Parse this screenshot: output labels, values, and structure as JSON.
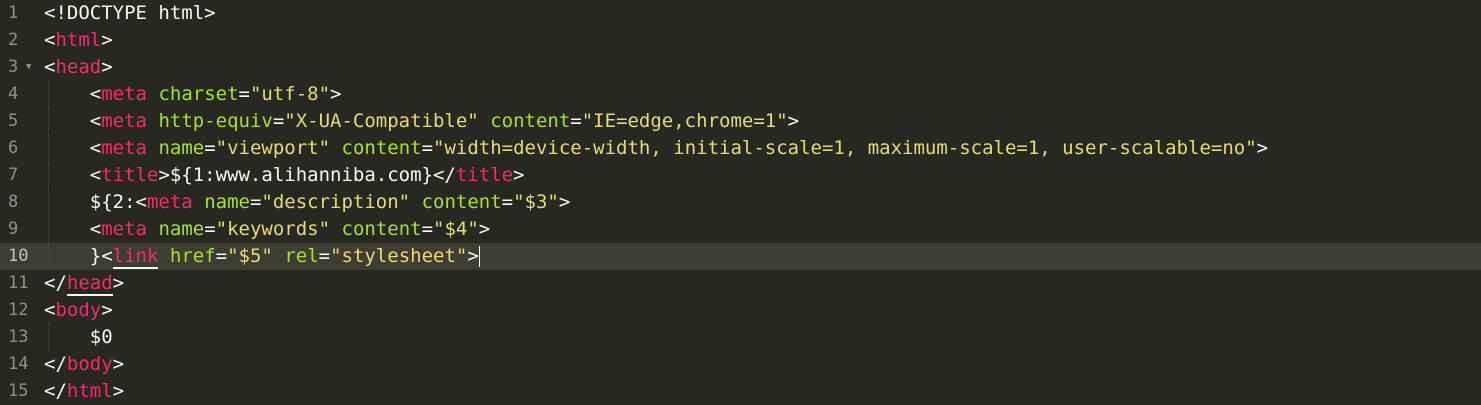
{
  "editor": {
    "lines": [
      {
        "num": "1",
        "indent": "",
        "tokens": [
          [
            "p",
            "<!DOCTYPE html>"
          ]
        ]
      },
      {
        "num": "2",
        "indent": "",
        "tokens": [
          [
            "p",
            "<"
          ],
          [
            "t",
            "html"
          ],
          [
            "p",
            ">"
          ]
        ]
      },
      {
        "num": "3",
        "indent": "",
        "fold": "▼",
        "tokens": [
          [
            "p",
            "<"
          ],
          [
            "t",
            "head"
          ],
          [
            "p",
            ">"
          ]
        ]
      },
      {
        "num": "4",
        "indent": "    ",
        "tokens": [
          [
            "p",
            "<"
          ],
          [
            "t",
            "meta"
          ],
          [
            "p",
            " "
          ],
          [
            "a",
            "charset"
          ],
          [
            "p",
            "="
          ],
          [
            "s",
            "\"utf-8\""
          ],
          [
            "p",
            ">"
          ]
        ]
      },
      {
        "num": "5",
        "indent": "    ",
        "tokens": [
          [
            "p",
            "<"
          ],
          [
            "t",
            "meta"
          ],
          [
            "p",
            " "
          ],
          [
            "a",
            "http-equiv"
          ],
          [
            "p",
            "="
          ],
          [
            "s",
            "\"X-UA-Compatible\""
          ],
          [
            "p",
            " "
          ],
          [
            "a",
            "content"
          ],
          [
            "p",
            "="
          ],
          [
            "s",
            "\"IE=edge,chrome=1\""
          ],
          [
            "p",
            ">"
          ]
        ]
      },
      {
        "num": "6",
        "indent": "    ",
        "tokens": [
          [
            "p",
            "<"
          ],
          [
            "t",
            "meta"
          ],
          [
            "p",
            " "
          ],
          [
            "a",
            "name"
          ],
          [
            "p",
            "="
          ],
          [
            "s",
            "\"viewport\""
          ],
          [
            "p",
            " "
          ],
          [
            "a",
            "content"
          ],
          [
            "p",
            "="
          ],
          [
            "s",
            "\"width=device-width, initial-scale=1, maximum-scale=1, user-scalable=no\""
          ],
          [
            "p",
            ">"
          ]
        ]
      },
      {
        "num": "7",
        "indent": "    ",
        "tokens": [
          [
            "p",
            "<"
          ],
          [
            "t",
            "title"
          ],
          [
            "p",
            ">${1:www.alihanniba.com}</"
          ],
          [
            "t",
            "title"
          ],
          [
            "p",
            ">"
          ]
        ]
      },
      {
        "num": "8",
        "indent": "    ",
        "tokens": [
          [
            "p",
            "${2:<"
          ],
          [
            "t",
            "meta"
          ],
          [
            "p",
            " "
          ],
          [
            "a",
            "name"
          ],
          [
            "p",
            "="
          ],
          [
            "s",
            "\"description\""
          ],
          [
            "p",
            " "
          ],
          [
            "a",
            "content"
          ],
          [
            "p",
            "="
          ],
          [
            "s",
            "\"$3\""
          ],
          [
            "p",
            ">"
          ]
        ]
      },
      {
        "num": "9",
        "indent": "    ",
        "tokens": [
          [
            "p",
            "<"
          ],
          [
            "t",
            "meta"
          ],
          [
            "p",
            " "
          ],
          [
            "a",
            "name"
          ],
          [
            "p",
            "="
          ],
          [
            "s",
            "\"keywords\""
          ],
          [
            "p",
            " "
          ],
          [
            "a",
            "content"
          ],
          [
            "p",
            "="
          ],
          [
            "s",
            "\"$4\""
          ],
          [
            "p",
            ">"
          ]
        ]
      },
      {
        "num": "10",
        "indent": "    ",
        "active": true,
        "tokens": [
          [
            "p",
            "}<"
          ],
          [
            "tm",
            "link"
          ],
          [
            "p",
            " "
          ],
          [
            "a",
            "href"
          ],
          [
            "p",
            "="
          ],
          [
            "s",
            "\"$5\""
          ],
          [
            "p",
            " "
          ],
          [
            "a",
            "rel"
          ],
          [
            "p",
            "="
          ],
          [
            "s",
            "\"stylesheet\""
          ],
          [
            "p",
            ">"
          ],
          [
            "cursor",
            ""
          ]
        ]
      },
      {
        "num": "11",
        "indent": "",
        "tokens": [
          [
            "p",
            "</"
          ],
          [
            "tm",
            "head"
          ],
          [
            "p",
            ">"
          ]
        ]
      },
      {
        "num": "12",
        "indent": "",
        "tokens": [
          [
            "p",
            "<"
          ],
          [
            "t",
            "body"
          ],
          [
            "p",
            ">"
          ]
        ]
      },
      {
        "num": "13",
        "indent": "    ",
        "tokens": [
          [
            "p",
            "$0"
          ]
        ]
      },
      {
        "num": "14",
        "indent": "",
        "tokens": [
          [
            "p",
            "</"
          ],
          [
            "t",
            "body"
          ],
          [
            "p",
            ">"
          ]
        ]
      },
      {
        "num": "15",
        "indent": "",
        "tokens": [
          [
            "p",
            "</"
          ],
          [
            "t",
            "html"
          ],
          [
            "p",
            ">"
          ]
        ]
      }
    ]
  },
  "colors": {
    "background": "#272822",
    "active_line": "#3e3d32",
    "tag": "#f92672",
    "attribute": "#a6e22e",
    "string": "#e6db74",
    "plain": "#f8f8f2",
    "gutter": "#8f908a"
  }
}
